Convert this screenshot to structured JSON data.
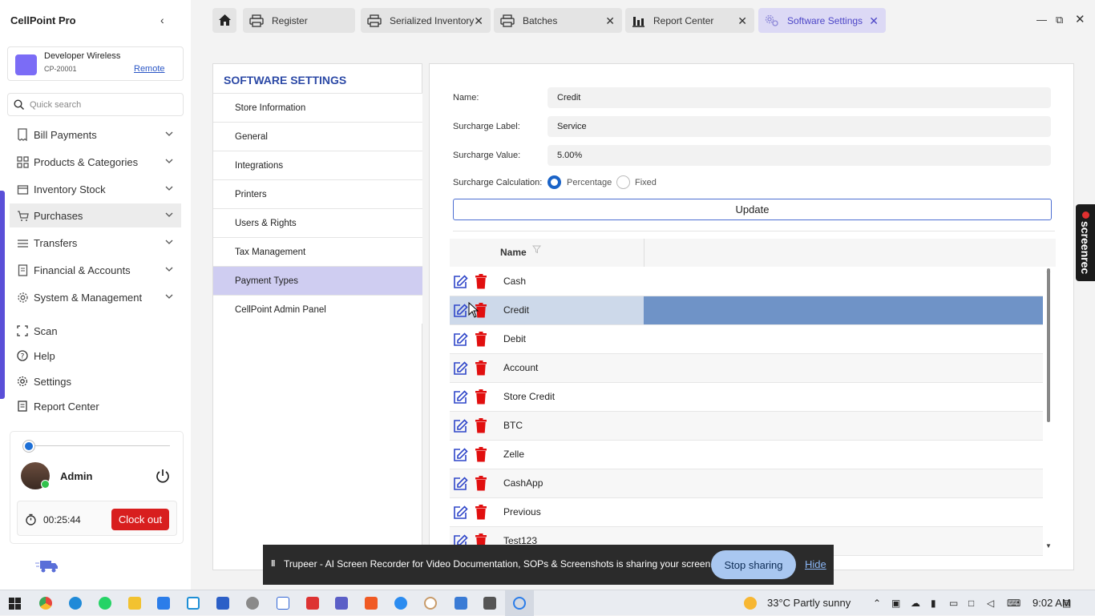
{
  "app": {
    "title": "CellPoint Pro"
  },
  "store": {
    "name": "Developer Wireless",
    "id": "CP-20001",
    "remote_label": "Remote"
  },
  "search": {
    "placeholder": "Quick search"
  },
  "nav": {
    "bill_payments": "Bill Payments",
    "products": "Products & Categories",
    "inventory": "Inventory Stock",
    "purchases": "Purchases",
    "transfers": "Transfers",
    "financial": "Financial & Accounts",
    "system": "System & Management",
    "scan": "Scan",
    "help": "Help",
    "settings": "Settings",
    "report_center": "Report Center"
  },
  "user": {
    "name": "Admin",
    "timer": "00:25:44",
    "clockout_label": "Clock out"
  },
  "tabs": {
    "register": "Register",
    "serialized": "Serialized Inventory",
    "batches": "Batches",
    "report": "Report Center",
    "software": "Software Settings"
  },
  "settings_menu": {
    "title": "SOFTWARE SETTINGS",
    "store_info": "Store Information",
    "general": "General",
    "integrations": "Integrations",
    "printers": "Printers",
    "users": "Users & Rights",
    "tax": "Tax Management",
    "payment_types": "Payment Types",
    "admin_panel": "CellPoint Admin Panel"
  },
  "form": {
    "name_label": "Name:",
    "name_value": "Credit",
    "surcharge_label_label": "Surcharge Label:",
    "surcharge_label_value": "Service",
    "surcharge_value_label": "Surcharge Value:",
    "surcharge_value_value": "5.00%",
    "calc_label": "Surcharge Calculation:",
    "opt_percentage": "Percentage",
    "opt_fixed": "Fixed",
    "selected_option": "Percentage",
    "update_label": "Update"
  },
  "grid": {
    "column_name": "Name",
    "rows": [
      "Cash",
      "Credit",
      "Debit",
      "Account",
      "Store Credit",
      "BTC",
      "Zelle",
      "CashApp",
      "Previous",
      "Test123"
    ],
    "selected_row": "Credit"
  },
  "screenrec": {
    "label": "screenrec"
  },
  "share_bar": {
    "message": "Trupeer - AI Screen Recorder for Video Documentation, SOPs & Screenshots is sharing your screen.",
    "stop_label": "Stop sharing",
    "hide_label": "Hide"
  },
  "taskbar": {
    "weather": "33°C  Partly sunny",
    "time": "9:02 AM"
  },
  "colors": {
    "accent": "#5a4fd8",
    "selected_row": "#6f93c7",
    "danger": "#d81e1e",
    "title_blue": "#2d4aa6"
  }
}
